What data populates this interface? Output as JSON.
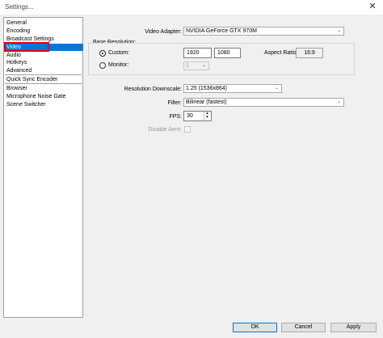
{
  "window": {
    "title": "Settings...",
    "close_glyph": "✕"
  },
  "sidebar": {
    "items": [
      {
        "label": "General"
      },
      {
        "label": "Encoding"
      },
      {
        "label": "Broadcast Settings"
      },
      {
        "label": "Video",
        "selected": true
      },
      {
        "label": "Audio"
      },
      {
        "label": "Hotkeys"
      },
      {
        "label": "Advanced"
      },
      {
        "label": "Quick Sync Encoder"
      },
      {
        "label": "Browser"
      },
      {
        "label": "Microphone Noise Gate"
      },
      {
        "label": "Scene Switcher"
      }
    ]
  },
  "video": {
    "adapter_label": "Video Adapter:",
    "adapter_value": "NVIDIA GeForce GTX 970M",
    "base_resolution_label": "Base Resolution:",
    "custom_label": "Custom:",
    "custom_width": "1920",
    "custom_height": "1080",
    "aspect_ratio_label": "Aspect Ratio:",
    "aspect_ratio_value": "16:9",
    "monitor_label": "Monitor:",
    "monitor_value": "1",
    "downscale_label": "Resolution Downscale:",
    "downscale_value": "1.25  (1536x864)",
    "filter_label": "Filter:",
    "filter_value": "Bilinear (fastest)",
    "fps_label": "FPS:",
    "fps_value": "30",
    "disable_aero_label": "Disable Aero:"
  },
  "buttons": {
    "ok": "OK",
    "cancel": "Cancel",
    "apply": "Apply"
  },
  "colors": {
    "selection": "#0078d7",
    "highlight_box": "#e0001b"
  }
}
